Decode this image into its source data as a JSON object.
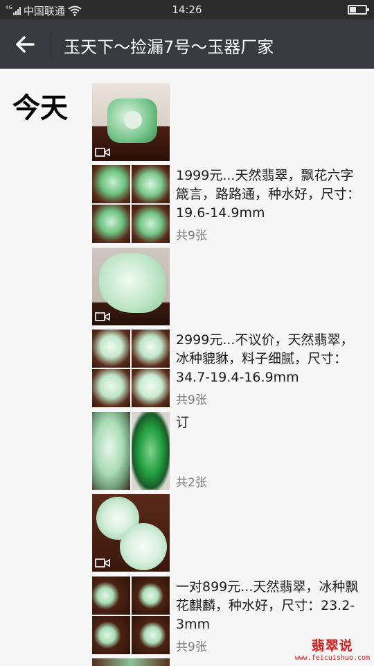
{
  "status": {
    "network_type": "4G",
    "carrier": "中国联通",
    "time": "14:26",
    "battery_level": 0.4
  },
  "header": {
    "back_icon": "arrow-left-icon",
    "title": "玉天下～捡漏7号～玉器厂家"
  },
  "feed": {
    "date_label": "今天",
    "posts": [
      {
        "kind": "video",
        "text": "",
        "count": ""
      },
      {
        "kind": "grid4",
        "text": "1999元...天然翡翠，飘花六字箴言，路路通，种水好，尺寸：19.6-14.9mm",
        "count": "共9张"
      },
      {
        "kind": "video",
        "text": "",
        "count": ""
      },
      {
        "kind": "grid4",
        "text": "2999元...不议价，天然翡翠，冰种貔貅，料子细腻，尺寸：34.7-19.4-16.9mm",
        "count": "共9张"
      },
      {
        "kind": "split2",
        "text": "订",
        "count": "共2张"
      },
      {
        "kind": "video",
        "text": "",
        "count": ""
      },
      {
        "kind": "grid4",
        "text": "一对899元...天然翡翠，冰种飘花麒麟，种水好，尺寸：23.2-3mm",
        "count": "共9张"
      }
    ]
  },
  "watermark": {
    "logo": "翡翠说",
    "url": "www.feicuishuo.com"
  }
}
